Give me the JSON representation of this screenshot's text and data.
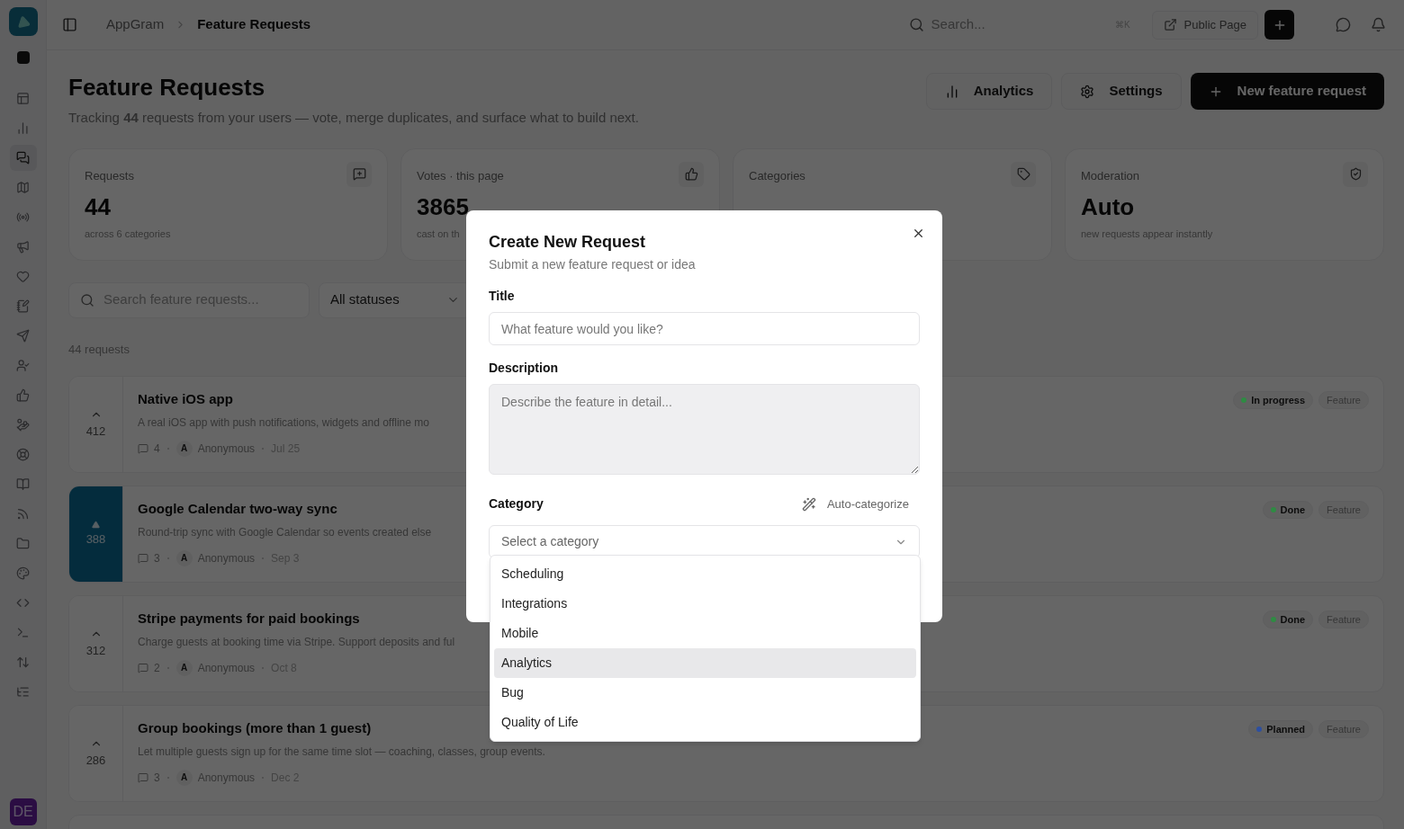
{
  "sidebar": {
    "items": [
      {
        "selected": false
      },
      {
        "selected": false
      },
      {
        "selected": true
      },
      {
        "selected": false
      },
      {
        "selected": false
      },
      {
        "selected": false
      },
      {
        "selected": false
      },
      {
        "selected": false
      },
      {
        "selected": false
      },
      {
        "selected": false
      },
      {
        "selected": false
      },
      {
        "selected": false
      },
      {
        "selected": false
      },
      {
        "selected": false
      },
      {
        "selected": false
      },
      {
        "selected": false
      },
      {
        "selected": false
      },
      {
        "selected": false
      },
      {
        "selected": false
      },
      {
        "selected": false
      },
      {
        "selected": false
      }
    ],
    "user_initials": "DE"
  },
  "topbar": {
    "breadcrumb": [
      "AppGram",
      "Feature Requests"
    ],
    "search": {
      "placeholder": "Search...",
      "shortcut": "⌘K"
    },
    "public_page": "Public Page"
  },
  "header": {
    "title": "Feature Requests",
    "subtitle": "Tracking **44** requests from your users — vote, merge duplicates, and surface what to build next.",
    "buttons": [
      {
        "label": "Analytics",
        "kind": "analytics"
      },
      {
        "label": "Settings",
        "kind": "settings"
      },
      {
        "label": "New feature request",
        "kind": "primary"
      }
    ]
  },
  "stats": [
    {
      "label": "Requests",
      "value": "44",
      "note": "across 6 categories",
      "kind": "requests"
    },
    {
      "label": "Votes · this page",
      "value": "3865",
      "note": "cast on th",
      "kind": "votes"
    },
    {
      "label": "Categories",
      "kind": "categories"
    },
    {
      "label": "Moderation",
      "value": "Auto",
      "note": "new requests appear instantly",
      "kind": "moderation"
    }
  ],
  "filters": {
    "search_placeholder": "Search feature requests...",
    "status": "All statuses"
  },
  "count": "44 requests",
  "requests": [
    {
      "votes": "412",
      "voted": false,
      "title": "Native iOS app",
      "description": "A real iOS app with push notifications, widgets and offline mo",
      "comments": "4",
      "avatar": "A",
      "author": "Anonymous",
      "date": "Jul 25",
      "status": {
        "label": "In progress",
        "color": "#2e8b43"
      },
      "tag": "Feature"
    },
    {
      "votes": "388",
      "voted": true,
      "title": "Google Calendar two-way sync",
      "description": "Round-trip sync with Google Calendar so events created else",
      "comments": "3",
      "avatar": "A",
      "author": "Anonymous",
      "date": "Sep 3",
      "status": {
        "label": "Done",
        "color": "#2e8b43"
      },
      "tag": "Feature"
    },
    {
      "votes": "312",
      "voted": false,
      "title": "Stripe payments for paid bookings",
      "description": "Charge guests at booking time via Stripe. Support deposits and ful",
      "comments": "2",
      "avatar": "A",
      "author": "Anonymous",
      "date": "Oct 8",
      "status": {
        "label": "Done",
        "color": "#2e8b43"
      },
      "tag": "Feature"
    },
    {
      "votes": "286",
      "voted": false,
      "title": "Group bookings (more than 1 guest)",
      "description": "Let multiple guests sign up for the same time slot — coaching, classes, group events.",
      "comments": "3",
      "avatar": "A",
      "author": "Anonymous",
      "date": "Dec 2",
      "status": {
        "label": "Planned",
        "color": "#2d4fa0"
      },
      "tag": "Feature"
    }
  ],
  "dialog": {
    "title": "Create New Request",
    "subtitle": "Submit a new feature request or idea",
    "title_label": "Title",
    "title_placeholder": "What feature would you like?",
    "description_label": "Description",
    "description_placeholder": "Describe the feature in detail...",
    "category_label": "Category",
    "auto_categorize": "Auto-categorize",
    "category_placeholder": "Select a category",
    "options": [
      {
        "label": "Scheduling",
        "highlighted": false
      },
      {
        "label": "Integrations",
        "highlighted": false
      },
      {
        "label": "Mobile",
        "highlighted": false
      },
      {
        "label": "Analytics",
        "highlighted": true
      },
      {
        "label": "Bug",
        "highlighted": false
      },
      {
        "label": "Quality of Life",
        "highlighted": false
      }
    ]
  }
}
